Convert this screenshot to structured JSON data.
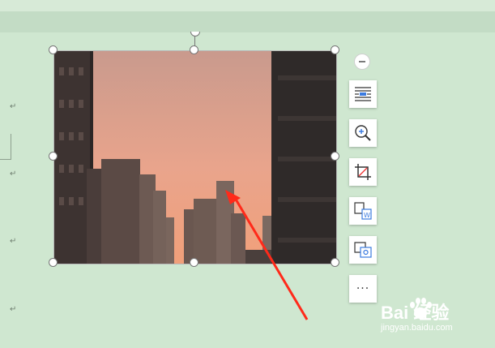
{
  "document": {
    "paragraph_mark": "↵",
    "paragraph_marks_count": 4
  },
  "image": {
    "description_colors": {
      "sky_top": "#d8a496",
      "sky_bottom": "#f0a07f",
      "buildings": "#3a3433"
    }
  },
  "toolbar": {
    "items": [
      {
        "name": "wrap-text",
        "icon": "wrap-text-icon"
      },
      {
        "name": "zoom",
        "icon": "zoom-in-icon"
      },
      {
        "name": "crop",
        "icon": "crop-icon"
      },
      {
        "name": "convert",
        "icon": "image-convert-icon"
      },
      {
        "name": "replace",
        "icon": "replace-image-icon"
      },
      {
        "name": "more",
        "icon": "more-icon",
        "label": "···"
      }
    ]
  },
  "watermark": {
    "brand": "Bai  经验",
    "site": "jingyan.baidu.com"
  },
  "annotation": {
    "color": "#ff2a1a"
  }
}
